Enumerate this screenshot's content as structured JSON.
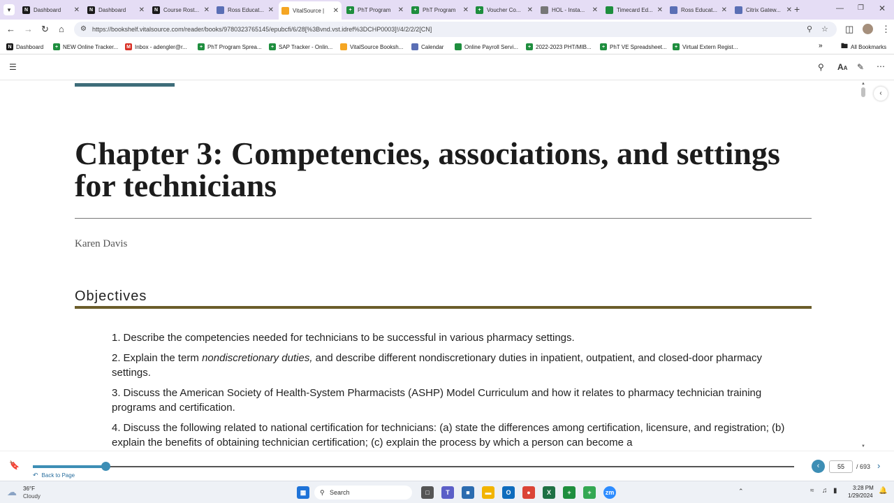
{
  "browser": {
    "tabs": [
      {
        "label": "Dashboard",
        "favicon_color": "#1a1a1a",
        "favicon_glyph": "N",
        "active": false
      },
      {
        "label": "Dashboard",
        "favicon_color": "#1a1a1a",
        "favicon_glyph": "N",
        "active": false
      },
      {
        "label": "Course Rost...",
        "favicon_color": "#1a1a1a",
        "favicon_glyph": "N",
        "active": false
      },
      {
        "label": "Ross Educat...",
        "favicon_color": "#5a6fb5",
        "favicon_glyph": "",
        "active": false
      },
      {
        "label": "VitalSource |",
        "favicon_color": "#f5a623",
        "favicon_glyph": "",
        "active": true
      },
      {
        "label": "PhT Program",
        "favicon_color": "#1e8e3e",
        "favicon_glyph": "+",
        "active": false
      },
      {
        "label": "PhT Program",
        "favicon_color": "#1e8e3e",
        "favicon_glyph": "+",
        "active": false
      },
      {
        "label": "Voucher Co...",
        "favicon_color": "#1e8e3e",
        "favicon_glyph": "+",
        "active": false
      },
      {
        "label": "HOL - Insta...",
        "favicon_color": "#777777",
        "favicon_glyph": "",
        "active": false
      },
      {
        "label": "Timecard Ed...",
        "favicon_color": "#1e8e3e",
        "favicon_glyph": "",
        "active": false
      },
      {
        "label": "Ross Educat...",
        "favicon_color": "#5a6fb5",
        "favicon_glyph": "",
        "active": false
      },
      {
        "label": "Citrix Gatew...",
        "favicon_color": "#5a6fb5",
        "favicon_glyph": "",
        "active": false
      }
    ],
    "url": "https://bookshelf.vitalsource.com/reader/books/9780323765145/epubcfi/6/28[%3Bvnd.vst.idref%3DCHP0003]!/4/2/2/2[CN]",
    "bookmarks": [
      {
        "label": "Dashboard",
        "color": "#1a1a1a",
        "glyph": "N"
      },
      {
        "label": "NEW Online Tracker...",
        "color": "#1e8e3e",
        "glyph": "+"
      },
      {
        "label": "Inbox - adengler@r...",
        "color": "#d93025",
        "glyph": "M"
      },
      {
        "label": "PhT Program Sprea...",
        "color": "#1e8e3e",
        "glyph": "+"
      },
      {
        "label": "SAP Tracker - Onlin...",
        "color": "#1e8e3e",
        "glyph": "+"
      },
      {
        "label": "VitalSource Booksh...",
        "color": "#f5a623",
        "glyph": ""
      },
      {
        "label": "Calendar",
        "color": "#5a6fb5",
        "glyph": ""
      },
      {
        "label": "Online Payroll Servi...",
        "color": "#1e8e3e",
        "glyph": ""
      },
      {
        "label": "2022-2023 PHT/MIB...",
        "color": "#1e8e3e",
        "glyph": "+"
      },
      {
        "label": "PhT VE Spreadsheet...",
        "color": "#1e8e3e",
        "glyph": "+"
      },
      {
        "label": "Virtual Extern Regist...",
        "color": "#1e8e3e",
        "glyph": "+"
      }
    ],
    "all_bookmarks_label": "All Bookmarks"
  },
  "reader": {
    "chapter_title": "Chapter 3: Competencies, associations, and settings for technicians",
    "author": "Karen Davis",
    "objectives_heading": "Objectives",
    "objectives": [
      {
        "num": "1.",
        "pre": "Describe the competencies needed for technicians to be successful in various pharmacy settings.",
        "em": "",
        "post": ""
      },
      {
        "num": "2.",
        "pre": "Explain the term ",
        "em": "nondiscretionary duties,",
        "post": " and describe different nondiscretionary duties in inpatient, outpatient, and closed-door pharmacy settings."
      },
      {
        "num": "3.",
        "pre": "Discuss the American Society of Health-System Pharmacists (ASHP) Model Curriculum and how it relates to pharmacy technician training programs and certification.",
        "em": "",
        "post": ""
      },
      {
        "num": "4.",
        "pre": "Discuss the following related to national certification for technicians: (a) state the differences among certification, licensure, and registration; (b) explain the benefits of obtaining technician certification; (c) explain the process by which a person can become a",
        "em": "",
        "post": ""
      }
    ],
    "back_to_page": "Back to Page",
    "current_page": "55",
    "total_pages": "/ 693",
    "progress_fraction": 0.095,
    "accent_color": "#3d8eb5"
  },
  "taskbar": {
    "weather_temp": "36°F",
    "weather_desc": "Cloudy",
    "search_label": "Search",
    "time": "3:28 PM",
    "date": "1/29/2024"
  }
}
